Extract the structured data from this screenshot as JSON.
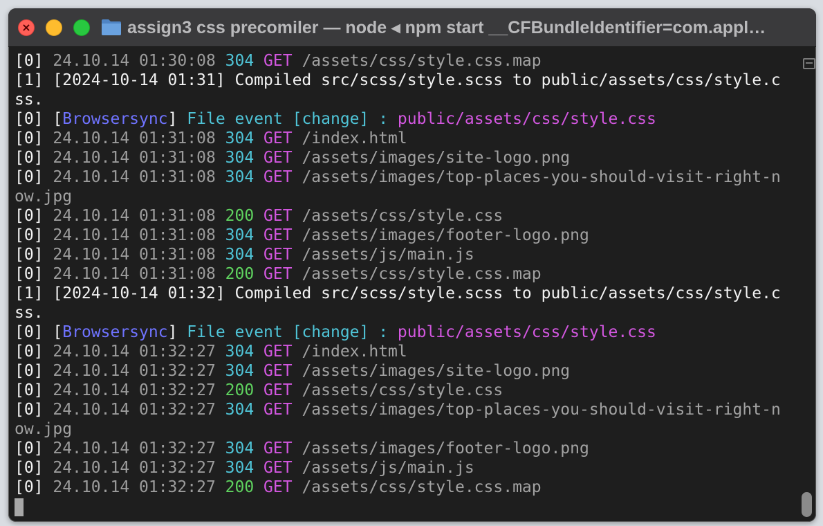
{
  "window": {
    "title": "assign3 css precomiler — node ◂ npm start __CFBundleIdentifier=com.appl…"
  },
  "colors": {
    "status_304": "#4fc4d7",
    "status_200": "#5fd35f",
    "method": "#d357e0",
    "browsersync": "#6f73ff"
  },
  "terminal": {
    "lines": [
      {
        "kind": "get",
        "prefix": "[0] ",
        "datetime": "24.10.14 01:30:08 ",
        "status": "304",
        "method": " GET ",
        "path": "/assets/css/style.css.map"
      },
      {
        "kind": "plain",
        "text": "[1] [2024-10-14 01:31] Compiled src/scss/style.scss to public/assets/css/style.c"
      },
      {
        "kind": "plain",
        "text": "ss."
      },
      {
        "kind": "bs",
        "prefix": "[0] [",
        "name": "Browsersync",
        "close": "] ",
        "event": "File event [change] : ",
        "file": "public/assets/css/style.css"
      },
      {
        "kind": "get",
        "prefix": "[0] ",
        "datetime": "24.10.14 01:31:08 ",
        "status": "304",
        "method": " GET ",
        "path": "/index.html"
      },
      {
        "kind": "get",
        "prefix": "[0] ",
        "datetime": "24.10.14 01:31:08 ",
        "status": "304",
        "method": " GET ",
        "path": "/assets/images/site-logo.png"
      },
      {
        "kind": "get",
        "prefix": "[0] ",
        "datetime": "24.10.14 01:31:08 ",
        "status": "304",
        "method": " GET ",
        "path": "/assets/images/top-places-you-should-visit-right-n"
      },
      {
        "kind": "wrap",
        "text": "ow.jpg"
      },
      {
        "kind": "get",
        "prefix": "[0] ",
        "datetime": "24.10.14 01:31:08 ",
        "status": "200",
        "method": " GET ",
        "path": "/assets/css/style.css"
      },
      {
        "kind": "get",
        "prefix": "[0] ",
        "datetime": "24.10.14 01:31:08 ",
        "status": "304",
        "method": " GET ",
        "path": "/assets/images/footer-logo.png"
      },
      {
        "kind": "get",
        "prefix": "[0] ",
        "datetime": "24.10.14 01:31:08 ",
        "status": "304",
        "method": " GET ",
        "path": "/assets/js/main.js"
      },
      {
        "kind": "get",
        "prefix": "[0] ",
        "datetime": "24.10.14 01:31:08 ",
        "status": "200",
        "method": " GET ",
        "path": "/assets/css/style.css.map"
      },
      {
        "kind": "plain",
        "text": "[1] [2024-10-14 01:32] Compiled src/scss/style.scss to public/assets/css/style.c"
      },
      {
        "kind": "plain",
        "text": "ss."
      },
      {
        "kind": "bs",
        "prefix": "[0] [",
        "name": "Browsersync",
        "close": "] ",
        "event": "File event [change] : ",
        "file": "public/assets/css/style.css"
      },
      {
        "kind": "get",
        "prefix": "[0] ",
        "datetime": "24.10.14 01:32:27 ",
        "status": "304",
        "method": " GET ",
        "path": "/index.html"
      },
      {
        "kind": "get",
        "prefix": "[0] ",
        "datetime": "24.10.14 01:32:27 ",
        "status": "304",
        "method": " GET ",
        "path": "/assets/images/site-logo.png"
      },
      {
        "kind": "get",
        "prefix": "[0] ",
        "datetime": "24.10.14 01:32:27 ",
        "status": "200",
        "method": " GET ",
        "path": "/assets/css/style.css"
      },
      {
        "kind": "get",
        "prefix": "[0] ",
        "datetime": "24.10.14 01:32:27 ",
        "status": "304",
        "method": " GET ",
        "path": "/assets/images/top-places-you-should-visit-right-n"
      },
      {
        "kind": "wrap",
        "text": "ow.jpg"
      },
      {
        "kind": "get",
        "prefix": "[0] ",
        "datetime": "24.10.14 01:32:27 ",
        "status": "304",
        "method": " GET ",
        "path": "/assets/images/footer-logo.png"
      },
      {
        "kind": "get",
        "prefix": "[0] ",
        "datetime": "24.10.14 01:32:27 ",
        "status": "304",
        "method": " GET ",
        "path": "/assets/js/main.js"
      },
      {
        "kind": "get",
        "prefix": "[0] ",
        "datetime": "24.10.14 01:32:27 ",
        "status": "200",
        "method": " GET ",
        "path": "/assets/css/style.css.map"
      }
    ]
  },
  "icons": {
    "close": "close-icon",
    "folder": "folder-icon",
    "scroll_to_top": "marks-icon"
  }
}
